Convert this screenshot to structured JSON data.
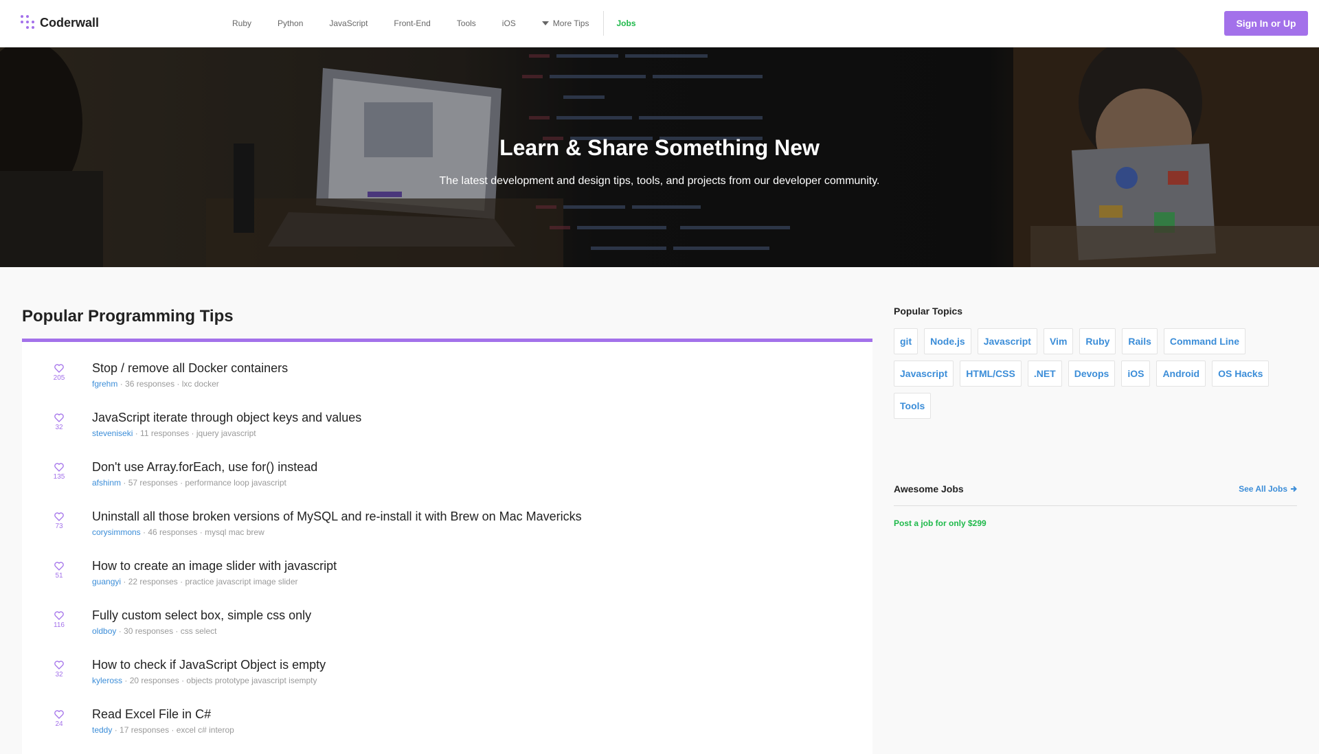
{
  "brand": {
    "name": "Coderwall"
  },
  "nav": {
    "links": [
      "Ruby",
      "Python",
      "JavaScript",
      "Front-End",
      "Tools",
      "iOS"
    ],
    "more_label": "More Tips",
    "jobs_label": "Jobs",
    "signin_label": "Sign In or Up"
  },
  "hero": {
    "title": "Learn & Share Something New",
    "subtitle": "The latest development and design tips, tools, and projects from our developer community."
  },
  "main": {
    "section_title": "Popular Programming Tips",
    "tips": [
      {
        "likes": "205",
        "title": "Stop / remove all Docker containers",
        "author": "fgrehm",
        "responses": "36 responses",
        "tags": "lxc docker"
      },
      {
        "likes": "32",
        "title": "JavaScript iterate through object keys and values",
        "author": "steveniseki",
        "responses": "11 responses",
        "tags": "jquery javascript"
      },
      {
        "likes": "135",
        "title": "Don't use Array.forEach, use for() instead",
        "author": "afshinm",
        "responses": "57 responses",
        "tags": "performance loop javascript"
      },
      {
        "likes": "73",
        "title": "Uninstall all those broken versions of MySQL and re-install it with Brew on Mac Mavericks",
        "author": "corysimmons",
        "responses": "46 responses",
        "tags": "mysql mac brew"
      },
      {
        "likes": "51",
        "title": "How to create an image slider with javascript",
        "author": "guangyi",
        "responses": "22 responses",
        "tags": "practice javascript image slider"
      },
      {
        "likes": "116",
        "title": "Fully custom select box, simple css only",
        "author": "oldboy",
        "responses": "30 responses",
        "tags": "css select"
      },
      {
        "likes": "32",
        "title": "How to check if JavaScript Object is empty",
        "author": "kyleross",
        "responses": "20 responses",
        "tags": "objects prototype javascript isempty"
      },
      {
        "likes": "24",
        "title": "Read Excel File in C#",
        "author": "teddy",
        "responses": "17 responses",
        "tags": "excel c# interop"
      }
    ]
  },
  "sidebar": {
    "topics_title": "Popular Topics",
    "topics": [
      "git",
      "Node.js",
      "Javascript",
      "Vim",
      "Ruby",
      "Rails",
      "Command Line",
      "Javascript",
      "HTML/CSS",
      ".NET",
      "Devops",
      "iOS",
      "Android",
      "OS Hacks",
      "Tools"
    ],
    "jobs_title": "Awesome Jobs",
    "see_all_label": "See All Jobs",
    "post_job_label": "Post a job for only $299"
  },
  "colors": {
    "accent": "#a371ea",
    "link": "#3b8dd8",
    "jobs_green": "#1eb94a"
  },
  "icons": {
    "heart": "heart-icon",
    "caret": "caret-down-icon",
    "arrow": "arrow-right-icon",
    "logo": "coderwall-logo-icon"
  }
}
